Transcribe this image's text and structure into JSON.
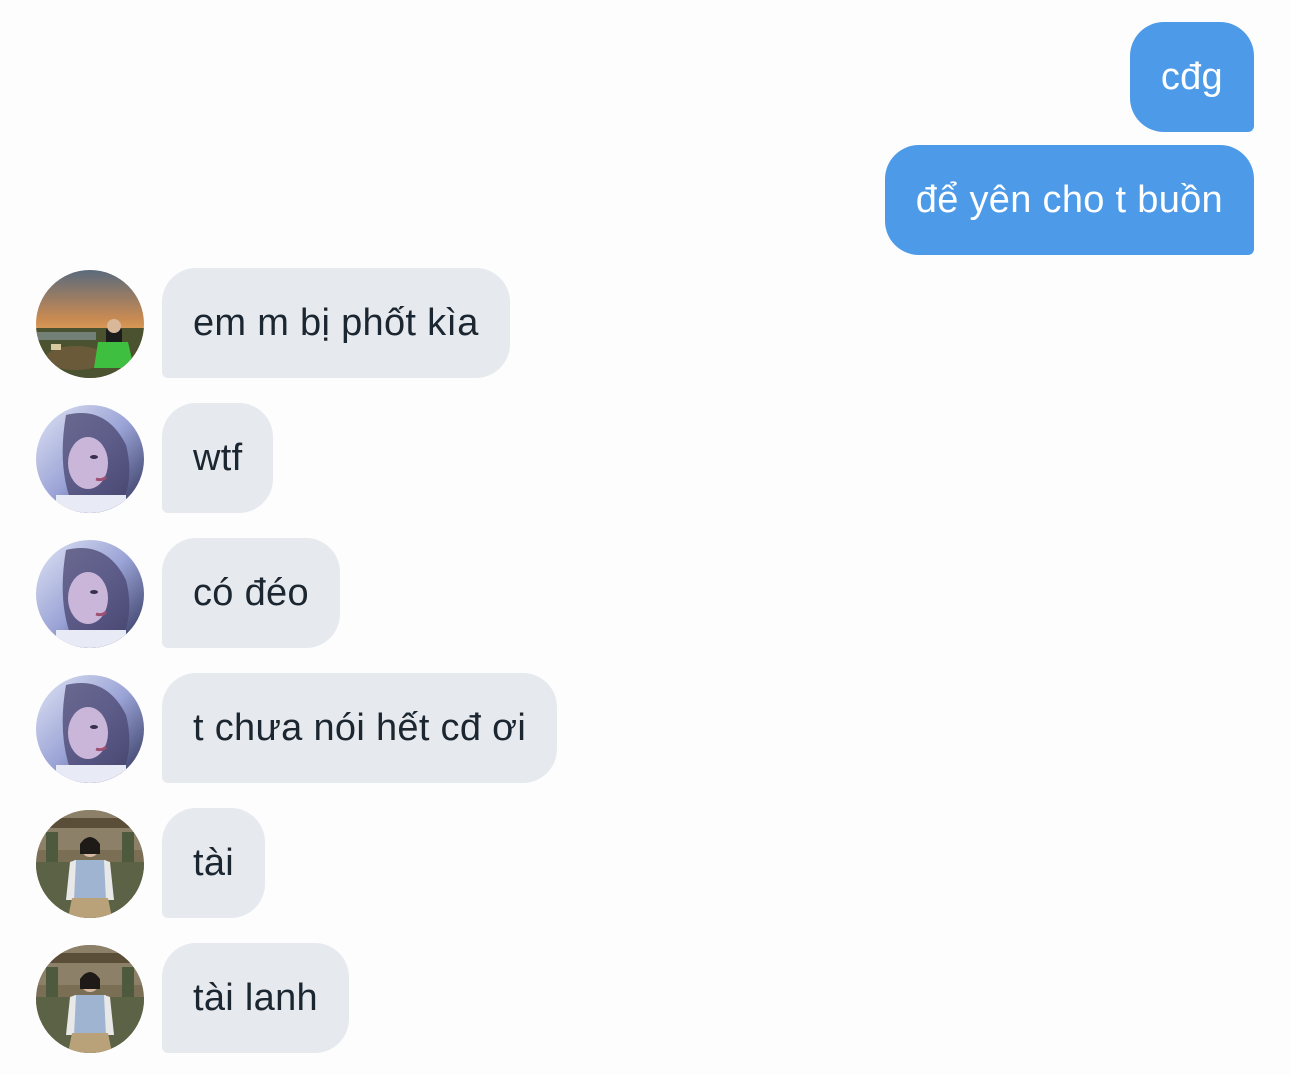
{
  "thread": {
    "outgoing": [
      {
        "text": "cđg"
      },
      {
        "text": "để yên cho t buồn"
      }
    ],
    "incoming": [
      {
        "text": "em m bị phốt kìa",
        "avatar": "avatar-sunset-field"
      },
      {
        "text": "wtf",
        "avatar": "avatar-blue-portrait"
      },
      {
        "text": "có đéo",
        "avatar": "avatar-blue-portrait"
      },
      {
        "text": "t chưa nói hết cđ ơi",
        "avatar": "avatar-blue-portrait"
      },
      {
        "text": "tài",
        "avatar": "avatar-courtyard"
      },
      {
        "text": "tài lanh",
        "avatar": "avatar-courtyard"
      }
    ]
  },
  "colors": {
    "outgoing_bubble": "#4d9be8",
    "incoming_bubble": "#e6eaef",
    "incoming_text": "#1c2630",
    "background": "#fdfdfe"
  }
}
